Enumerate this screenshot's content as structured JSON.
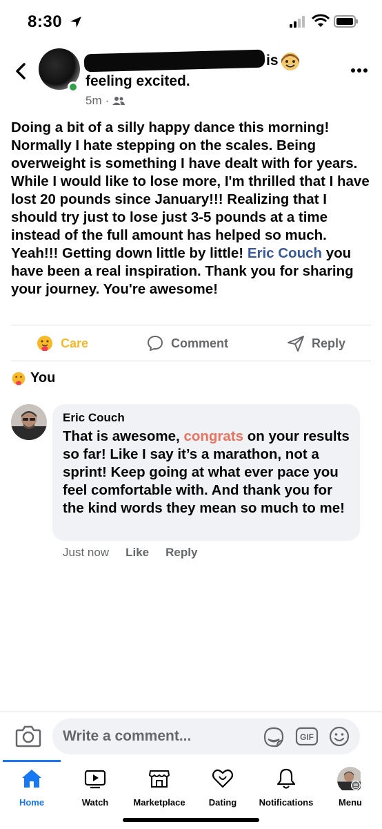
{
  "status_bar": {
    "time": "8:30"
  },
  "post": {
    "header_is": "is",
    "feeling": "feeling excited.",
    "time_ago": "5m",
    "audience_icon": "friends-icon",
    "body_part1": "Doing a bit of a silly happy dance this morning! Normally I hate stepping on the scales. Being overweight is something I have dealt with for years. While I would like to lose more, I'm thrilled that I have lost 20 pounds since January!!! Realizing that I should try just to lose just 3-5 pounds at a time instead of the full amount has helped so much. Yeah!!! Getting down little by little! ",
    "mention": "Eric Couch",
    "body_part2": " you have been a real inspiration. Thank you for sharing your journey. You're awesome!"
  },
  "actions": {
    "care_label": "Care",
    "comment_label": "Comment",
    "reply_label": "Reply"
  },
  "reactions": {
    "label": "You"
  },
  "comment": {
    "author": "Eric Couch",
    "text_part1": "That is awesome, ",
    "highlight": "congrats",
    "text_part2": " on your results so far! Like I say it’s a marathon, not a sprint! Keep going at what ever pace you feel comfortable with. And thank you for the kind words they mean so much to me!",
    "time": "Just now",
    "like_label": "Like",
    "reply_label": "Reply"
  },
  "composer": {
    "placeholder": "Write a comment..."
  },
  "tabs": [
    {
      "label": "Home",
      "icon": "home-icon",
      "active": true
    },
    {
      "label": "Watch",
      "icon": "watch-icon"
    },
    {
      "label": "Marketplace",
      "icon": "marketplace-icon"
    },
    {
      "label": "Dating",
      "icon": "dating-icon"
    },
    {
      "label": "Notifications",
      "icon": "bell-icon"
    },
    {
      "label": "Menu",
      "icon": "menu-avatar"
    }
  ],
  "colors": {
    "accent": "#1877f2",
    "care": "#f7b928",
    "mention": "#385898",
    "highlight": "#e9735e",
    "online": "#31a24c"
  }
}
